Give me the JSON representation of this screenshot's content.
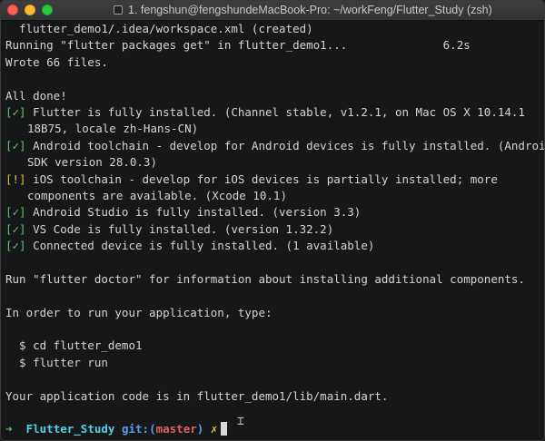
{
  "window": {
    "title": "1. fengshun@fengshundeMacBook-Pro: ~/workFeng/Flutter_Study (zsh)"
  },
  "terminal": {
    "lines": {
      "l0": "  flutter_demo1/.idea/workspace.xml (created)",
      "l1": "Running \"flutter packages get\" in flutter_demo1...              6.2s",
      "l2": "Wrote 66 files.",
      "l3": "",
      "l4": "All done!",
      "l5_mark": "[✓]",
      "l5": " Flutter is fully installed. (Channel stable, v1.2.1, on Mac OS X 10.14.1",
      "l5b": "18B75, locale zh-Hans-CN)",
      "l6_mark": "[✓]",
      "l6": " Android toolchain - develop for Android devices is fully installed. (Android",
      "l6b": "SDK version 28.0.3)",
      "l7_mark": "[!]",
      "l7": " iOS toolchain - develop for iOS devices is partially installed; more",
      "l7b": "components are available. (Xcode 10.1)",
      "l8_mark": "[✓]",
      "l8": " Android Studio is fully installed. (version 3.3)",
      "l9_mark": "[✓]",
      "l9": " VS Code is fully installed. (version 1.32.2)",
      "l10_mark": "[✓]",
      "l10": " Connected device is fully installed. (1 available)",
      "l11": "",
      "l12": "Run \"flutter doctor\" for information about installing additional components.",
      "l13": "",
      "l14": "In order to run your application, type:",
      "l15": "",
      "l16": "  $ cd flutter_demo1",
      "l17": "  $ flutter run",
      "l18": "",
      "l19": "Your application code is in flutter_demo1/lib/main.dart.",
      "l20": ""
    },
    "prompt": {
      "arrow": "➜",
      "dir": "Flutter_Study",
      "git_label": "git:",
      "branch_open": "(",
      "branch": "master",
      "branch_close": ")",
      "dirty": "✗"
    }
  },
  "colors": {
    "ok": "#5cc56a",
    "warn": "#e2c44a",
    "dir": "#4fd1e6",
    "git": "#5d9cf0",
    "branch": "#e05f5f",
    "background": "#161719"
  }
}
